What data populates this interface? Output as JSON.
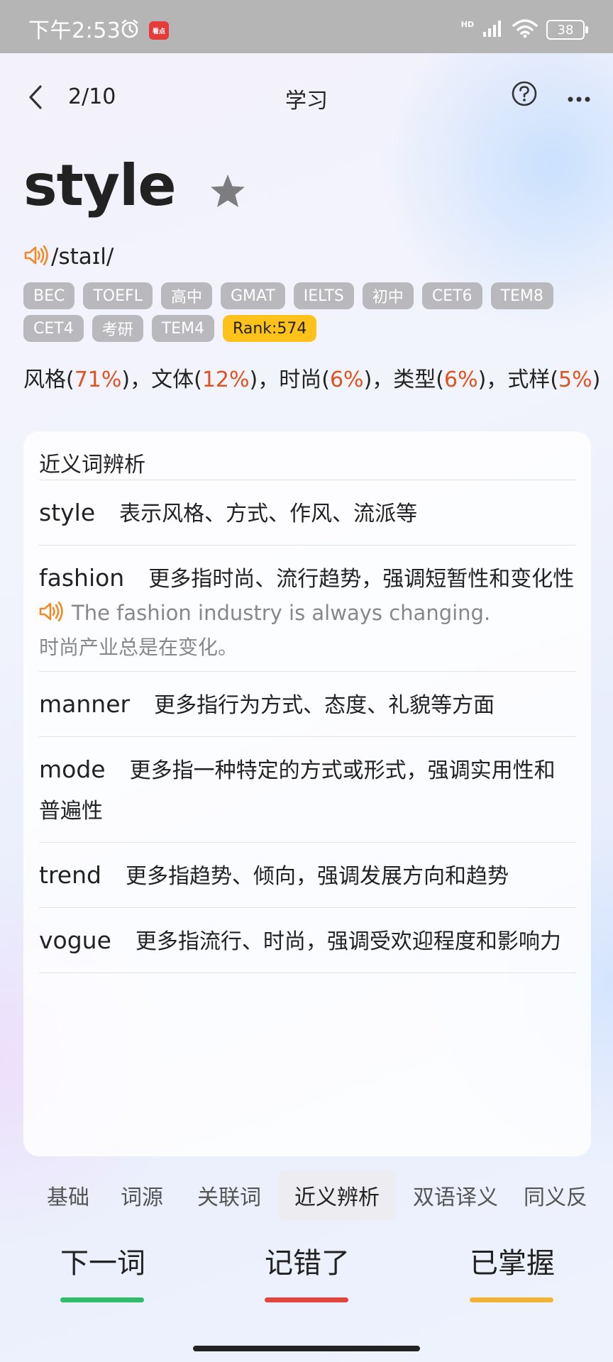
{
  "status_bar": {
    "time": "下午2:53",
    "app_badge": "看点",
    "network": "HD",
    "battery": "38"
  },
  "header": {
    "progress": "2/10",
    "title": "学习"
  },
  "word": {
    "text": "style",
    "phonetic": "/staɪl/",
    "tags": [
      "BEC",
      "TOEFL",
      "高中",
      "GMAT",
      "IELTS",
      "初中",
      "CET6",
      "TEM8",
      "CET4",
      "考研",
      "TEM4"
    ],
    "rank": "Rank:574",
    "meanings": [
      {
        "word": "风格",
        "pct": "71%"
      },
      {
        "word": "文体",
        "pct": "12%"
      },
      {
        "word": "时尚",
        "pct": "6%"
      },
      {
        "word": "类型",
        "pct": "6%"
      },
      {
        "word": "式样",
        "pct": "5%"
      }
    ]
  },
  "synonyms": {
    "title": "近义词辨析",
    "entries": [
      {
        "word": "style",
        "desc": "表示风格、方式、作风、流派等"
      },
      {
        "word": "fashion",
        "desc": "更多指时尚、流行趋势，强调短暂性和变化性",
        "example_en": "The fashion industry is always changing.",
        "example_cn": "时尚产业总是在变化。"
      },
      {
        "word": "manner",
        "desc": "更多指行为方式、态度、礼貌等方面"
      },
      {
        "word": "mode",
        "desc": "更多指一种特定的方式或形式，强调实用性和普遍性"
      },
      {
        "word": "trend",
        "desc": "更多指趋势、倾向，强调发展方向和趋势"
      },
      {
        "word": "vogue",
        "desc": "更多指流行、时尚，强调受欢迎程度和影响力"
      }
    ]
  },
  "tabs": [
    "基础",
    "词源",
    "关联词",
    "近义辨析",
    "双语译义",
    "同义反"
  ],
  "active_tab": "近义辨析",
  "actions": [
    {
      "label": "下一词",
      "color": "#2ebd6b"
    },
    {
      "label": "记错了",
      "color": "#e5463b"
    },
    {
      "label": "已掌握",
      "color": "#f2b234"
    }
  ],
  "colors": {
    "accent_orange": "#e0521f",
    "speaker_icon": "#f08a24",
    "tag_gray": "#b9b9bd",
    "rank_yellow": "#ffc21a"
  }
}
